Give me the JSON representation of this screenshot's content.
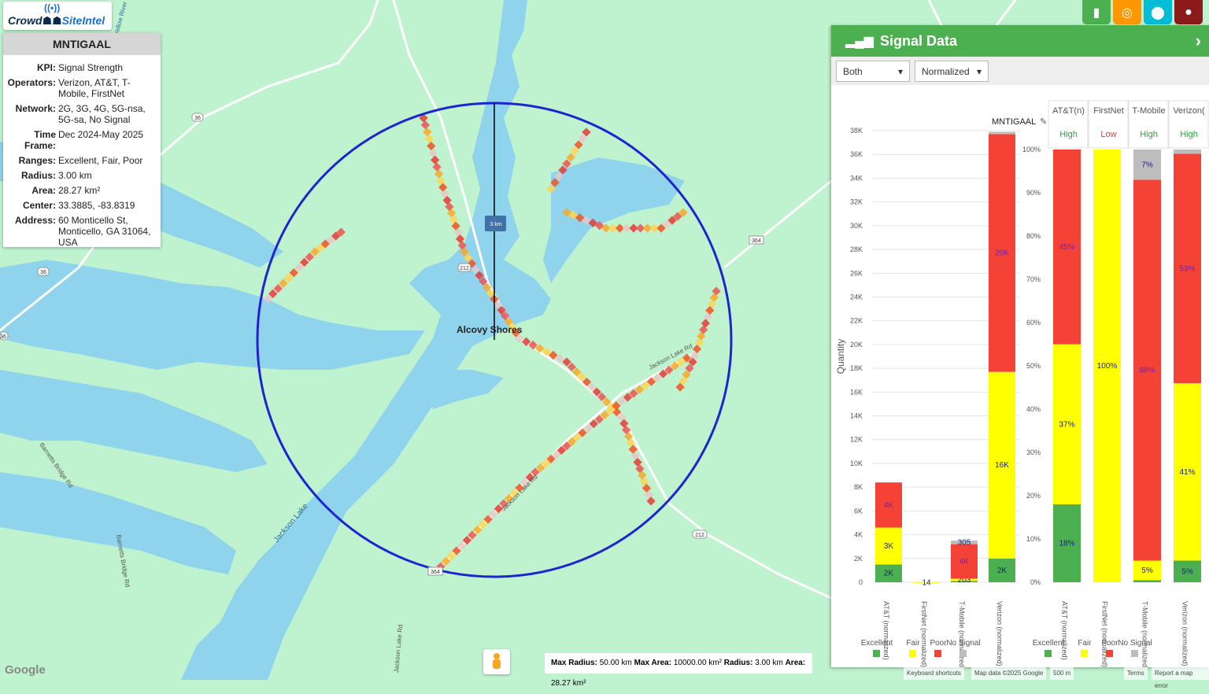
{
  "app": {
    "brand_a": "Crowd",
    "brand_b": "SiteIntel"
  },
  "info": {
    "title": "MNTIGAAL",
    "rows": [
      {
        "label": "KPI:",
        "value": "Signal Strength"
      },
      {
        "label": "Operators:",
        "value": "Verizon, AT&T, T-Mobile, FirstNet"
      },
      {
        "label": "Network:",
        "value": "2G, 3G, 4G, 5G-nsa, 5G-sa, No Signal"
      },
      {
        "label": "Time Frame:",
        "value": "Dec 2024-May 2025"
      },
      {
        "label": "Ranges:",
        "value": "Excellent, Fair, Poor"
      },
      {
        "label": "Radius:",
        "value": "3.00 km"
      },
      {
        "label": "Area:",
        "value": "28.27 km²"
      },
      {
        "label": "Center:",
        "value": "33.3885, -83.8319"
      },
      {
        "label": "Address:",
        "value": "60 Monticello St, Monticello, GA 31064, USA"
      }
    ]
  },
  "toolbar": {
    "icons": [
      {
        "name": "bar-chart-icon",
        "glyph": "▮",
        "color": "#4caf50"
      },
      {
        "name": "target-icon",
        "glyph": "◎",
        "color": "#ff9800"
      },
      {
        "name": "location-pin-icon",
        "glyph": "⬤",
        "color": "#00bcd4"
      },
      {
        "name": "globe-icon",
        "glyph": "●",
        "color": "#8b1a1a"
      }
    ]
  },
  "panel": {
    "title": "Signal Data",
    "network_select": "Both",
    "mode_select": "Normalized",
    "site_label": "MNTIGAAL"
  },
  "map": {
    "labels": {
      "town": "Alcovy Shores",
      "radius_tag": "3 km",
      "lake": "Jackson Lake",
      "road1": "Jackson Lake Rd",
      "road2": "Jackson Lake Rd",
      "road3": "Barnetts Bridge Rd",
      "road4": "Barnetts Bridge Rd",
      "road5": "Jackson Lake Rd",
      "river": "Yellow River"
    },
    "shields": [
      "36",
      "36",
      "364",
      "364",
      "212",
      "212",
      "36"
    ],
    "scale": {
      "k1": "Max Radius:",
      "v1": "50.00 km",
      "k2": "Max Area:",
      "v2": "10000.00 km²",
      "k3": "Radius:",
      "v3": "3.00 km",
      "k4": "Area:",
      "v4": "28.27 km²"
    },
    "footer": {
      "shortcuts": "Keyboard shortcuts",
      "mapdata": "Map data ©2025 Google",
      "scale": "500 m",
      "terms": "Terms",
      "report": "Report a map error",
      "google": "Google"
    }
  },
  "chart_data": [
    {
      "type": "bar",
      "stacked": true,
      "title": "MNTIGAAL",
      "ylabel": "Quantity",
      "ylim": [
        0,
        38000
      ],
      "yticks": [
        "0",
        "2K",
        "4K",
        "6K",
        "8K",
        "10K",
        "12K",
        "14K",
        "16K",
        "18K",
        "20K",
        "22K",
        "24K",
        "26K",
        "28K",
        "30K",
        "32K",
        "34K",
        "36K",
        "38K"
      ],
      "categories": [
        "AT&T (normalized)",
        "FirstNet (normalized)",
        "T-Mobile (normalized)",
        "Verizon (normalized)"
      ],
      "series": [
        {
          "name": "Excellent",
          "color": "#4caf50",
          "values": [
            1500,
            0,
            100,
            2000
          ],
          "labels": [
            "2K",
            "",
            "",
            "2K"
          ]
        },
        {
          "name": "Fair",
          "color": "#ffff00",
          "values": [
            3100,
            14,
            203,
            15700
          ],
          "labels": [
            "3K",
            "14",
            "203",
            "16K"
          ]
        },
        {
          "name": "Poor",
          "color": "#f44336",
          "values": [
            3800,
            0,
            2900,
            20000
          ],
          "labels": [
            "4K",
            "",
            "4K",
            "20K"
          ]
        },
        {
          "name": "No Signal",
          "color": "#bdbdbd",
          "values": [
            0,
            0,
            305,
            200
          ],
          "labels": [
            "",
            "",
            "305",
            ""
          ]
        }
      ]
    },
    {
      "type": "bar",
      "stacked": true,
      "ylim": [
        0,
        100
      ],
      "yticks": [
        "0%",
        "10%",
        "20%",
        "30%",
        "40%",
        "50%",
        "60%",
        "70%",
        "80%",
        "90%",
        "100%"
      ],
      "categories": [
        "AT&T (normalized)",
        "FirstNet (normalized)",
        "T-Mobile (normalized)",
        "Verizon (normalized)"
      ],
      "headers": [
        "AT&T(n)",
        "FirstNet",
        "T-Mobile",
        "Verizon("
      ],
      "ratings": [
        {
          "text": "High",
          "color": "#2e9e3e"
        },
        {
          "text": "Low",
          "color": "#e53935"
        },
        {
          "text": "High",
          "color": "#2e9e3e"
        },
        {
          "text": "High",
          "color": "#2e9e3e"
        }
      ],
      "series": [
        {
          "name": "Excellent",
          "color": "#4caf50",
          "values": [
            18,
            0,
            0.5,
            5
          ],
          "labels": [
            "18%",
            "",
            "",
            "5%"
          ]
        },
        {
          "name": "Fair",
          "color": "#ffff00",
          "values": [
            37,
            100,
            4.5,
            41
          ],
          "labels": [
            "37%",
            "100%",
            "5%",
            "41%"
          ]
        },
        {
          "name": "Poor",
          "color": "#f44336",
          "values": [
            45,
            0,
            88,
            53
          ],
          "labels": [
            "45%",
            "",
            "88%",
            "53%"
          ]
        },
        {
          "name": "No Signal",
          "color": "#bdbdbd",
          "values": [
            0,
            0,
            7,
            1
          ],
          "labels": [
            "",
            "",
            "7%",
            ""
          ]
        }
      ]
    }
  ]
}
